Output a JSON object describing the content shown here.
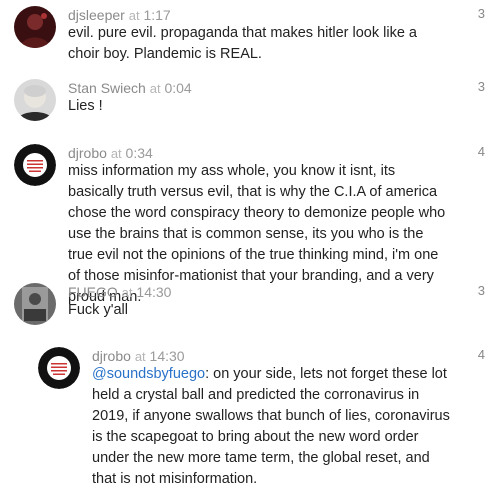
{
  "comments": [
    {
      "user": "djsleeper",
      "at": "at",
      "time": "1:17",
      "text": "evil. pure evil. propaganda that makes hitler look like a choir boy. Plandemic is REAL.",
      "count": "3"
    },
    {
      "user": "Stan Swiech",
      "at": "at",
      "time": "0:04",
      "text": "Lies !",
      "count": "3"
    },
    {
      "user": "djrobo",
      "at": "at",
      "time": "0:34",
      "text": "miss information my ass whole, you know it isnt, its basically truth versus evil, that is why the C.I.A of america chose the word conspiracy theory to demonize people who use the brains that is common sense, its you who is the true evil not the opinions of the true thinking mind, i'm one of those misinfor-mationist that your branding, and a very proud man.",
      "count": "4"
    },
    {
      "user": "FUEGO",
      "at": "at",
      "time": "14:30",
      "text": "Fuck y'all",
      "count": "3"
    },
    {
      "user": "djrobo",
      "at": "at",
      "time": "14:30",
      "mention": "@soundsbyfuego",
      "text": ": on your side, lets not forget these lot held a crystal ball and predicted the corronavirus in 2019, if anyone swallows that bunch of lies, coronavirus is the scapegoat to bring about the new word order under the new more tame term, the global reset, and that is not misinformation.",
      "count": "4"
    }
  ]
}
